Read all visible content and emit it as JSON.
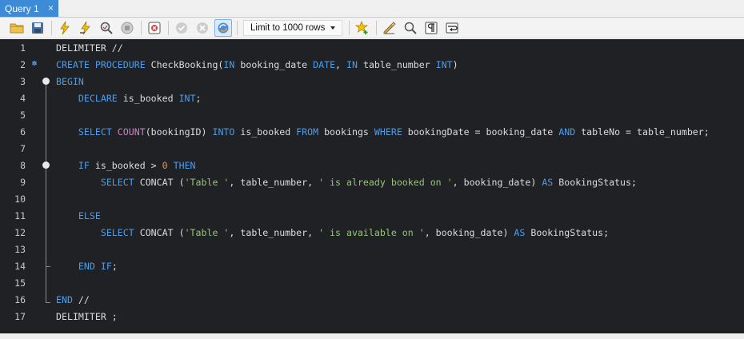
{
  "tabs": [
    {
      "label": "Query 1",
      "close": "×"
    }
  ],
  "toolbar": {
    "limit_label": "Limit to 1000 rows",
    "buttons": [
      "open-file-icon",
      "save-icon",
      "execute-icon",
      "execute-current-icon",
      "explain-icon",
      "stop-icon",
      "toggle-error-icon",
      "commit-icon",
      "rollback-icon",
      "autocommit-icon",
      "add-snippet-icon",
      "beautify-icon",
      "find-icon",
      "invisible-chars-icon",
      "word-wrap-icon"
    ]
  },
  "editor": {
    "line_numbers": [
      "1",
      "2",
      "3",
      "4",
      "5",
      "6",
      "7",
      "8",
      "9",
      "10",
      "11",
      "12",
      "13",
      "14",
      "15",
      "16",
      "17"
    ],
    "lines": [
      [
        {
          "t": "DELIMITER //",
          "c": ""
        }
      ],
      [
        {
          "t": "CREATE PROCEDURE",
          "c": "kw"
        },
        {
          "t": " CheckBooking(",
          "c": ""
        },
        {
          "t": "IN",
          "c": "kw"
        },
        {
          "t": " booking_date ",
          "c": ""
        },
        {
          "t": "DATE",
          "c": "kw"
        },
        {
          "t": ", ",
          "c": ""
        },
        {
          "t": "IN",
          "c": "kw"
        },
        {
          "t": " table_number ",
          "c": ""
        },
        {
          "t": "INT",
          "c": "kw"
        },
        {
          "t": ")",
          "c": ""
        }
      ],
      [
        {
          "t": "BEGIN",
          "c": "kw"
        }
      ],
      [
        {
          "t": "    ",
          "c": ""
        },
        {
          "t": "DECLARE",
          "c": "kw"
        },
        {
          "t": " is_booked ",
          "c": ""
        },
        {
          "t": "INT",
          "c": "kw"
        },
        {
          "t": ";",
          "c": ""
        }
      ],
      [],
      [
        {
          "t": "    ",
          "c": ""
        },
        {
          "t": "SELECT",
          "c": "kw"
        },
        {
          "t": " ",
          "c": ""
        },
        {
          "t": "COUNT",
          "c": "fn"
        },
        {
          "t": "(bookingID) ",
          "c": ""
        },
        {
          "t": "INTO",
          "c": "kw"
        },
        {
          "t": " is_booked ",
          "c": ""
        },
        {
          "t": "FROM",
          "c": "kw"
        },
        {
          "t": " bookings ",
          "c": ""
        },
        {
          "t": "WHERE",
          "c": "kw"
        },
        {
          "t": " bookingDate = booking_date ",
          "c": ""
        },
        {
          "t": "AND",
          "c": "kw"
        },
        {
          "t": " tableNo = table_number;",
          "c": ""
        }
      ],
      [],
      [
        {
          "t": "    ",
          "c": ""
        },
        {
          "t": "IF",
          "c": "kw"
        },
        {
          "t": " is_booked > ",
          "c": ""
        },
        {
          "t": "0",
          "c": "num"
        },
        {
          "t": " ",
          "c": ""
        },
        {
          "t": "THEN",
          "c": "kw"
        }
      ],
      [
        {
          "t": "        ",
          "c": ""
        },
        {
          "t": "SELECT",
          "c": "kw"
        },
        {
          "t": " CONCAT (",
          "c": ""
        },
        {
          "t": "'Table '",
          "c": "str"
        },
        {
          "t": ", table_number, ",
          "c": ""
        },
        {
          "t": "' is already booked on '",
          "c": "str"
        },
        {
          "t": ", booking_date) ",
          "c": ""
        },
        {
          "t": "AS",
          "c": "kw"
        },
        {
          "t": " BookingStatus;",
          "c": ""
        }
      ],
      [],
      [
        {
          "t": "    ",
          "c": ""
        },
        {
          "t": "ELSE",
          "c": "kw"
        }
      ],
      [
        {
          "t": "        ",
          "c": ""
        },
        {
          "t": "SELECT",
          "c": "kw"
        },
        {
          "t": " CONCAT (",
          "c": ""
        },
        {
          "t": "'Table '",
          "c": "str"
        },
        {
          "t": ", table_number, ",
          "c": ""
        },
        {
          "t": "' is available on '",
          "c": "str"
        },
        {
          "t": ", booking_date) ",
          "c": ""
        },
        {
          "t": "AS",
          "c": "kw"
        },
        {
          "t": " BookingStatus;",
          "c": ""
        }
      ],
      [],
      [
        {
          "t": "    ",
          "c": ""
        },
        {
          "t": "END IF",
          "c": "kw"
        },
        {
          "t": ";",
          "c": ""
        }
      ],
      [],
      [
        {
          "t": "END",
          "c": "kw"
        },
        {
          "t": " //",
          "c": ""
        }
      ],
      [
        {
          "t": "DELIMITER ;",
          "c": ""
        }
      ]
    ]
  },
  "colors": {
    "tab_active": "#3d8ad6",
    "editor_bg": "#1f2124",
    "keyword": "#4f9de8",
    "function": "#c586c0",
    "string": "#98c379",
    "number": "#d19a66"
  }
}
